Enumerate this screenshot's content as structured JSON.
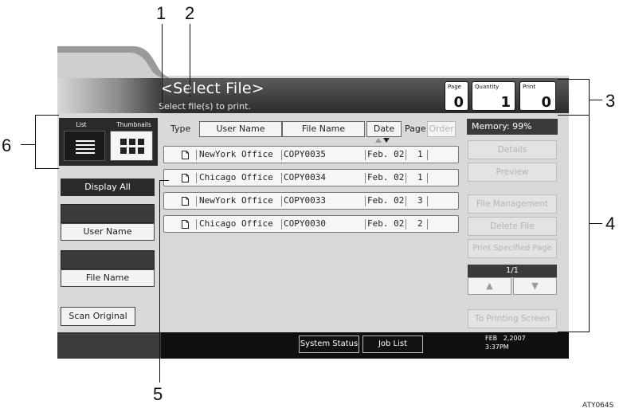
{
  "title": "<Select File>",
  "subtitle": "Select file(s) to print.",
  "counters": [
    {
      "caption": "Page",
      "value": "0"
    },
    {
      "caption": "Quantity",
      "value": "1"
    },
    {
      "caption": "Print",
      "value": "0"
    }
  ],
  "view_toggle": {
    "list_label": "List",
    "thumbnails_label": "Thumbnails"
  },
  "left": {
    "display_all": "Display All",
    "user_name": "User Name",
    "file_name": "File Name",
    "scan_original": "Scan Original"
  },
  "table_header": {
    "type": "Type",
    "user_name": "User Name",
    "file_name": "File Name",
    "date": "Date",
    "page": "Page",
    "order": "Order"
  },
  "rows": [
    {
      "user": "NewYork Office",
      "file": "COPY0035",
      "date": "Feb. 02",
      "pages": "1"
    },
    {
      "user": "Chicago Office",
      "file": "COPY0034",
      "date": "Feb. 02",
      "pages": "1"
    },
    {
      "user": "NewYork Office",
      "file": "COPY0033",
      "date": "Feb. 02",
      "pages": "3"
    },
    {
      "user": "Chicago Office",
      "file": "COPY0030",
      "date": "Feb. 02",
      "pages": "2"
    }
  ],
  "right": {
    "memory": "Memory:  99%",
    "details": "Details",
    "preview": "Preview",
    "file_management": "File Management",
    "delete_file": "Delete File",
    "print_specified_page": "Print Specified Page",
    "page_indicator": "1/1",
    "up_arrow": "▲",
    "down_arrow": "▼",
    "to_printing_screen": "To Printing Screen"
  },
  "status_bar": {
    "system_status": "System Status",
    "job_list": "Job List",
    "date": "FEB   2,2007",
    "time": "3:37PM"
  },
  "callouts": [
    "1",
    "2",
    "3",
    "4",
    "5",
    "6"
  ],
  "figure_code": "ATY064S"
}
